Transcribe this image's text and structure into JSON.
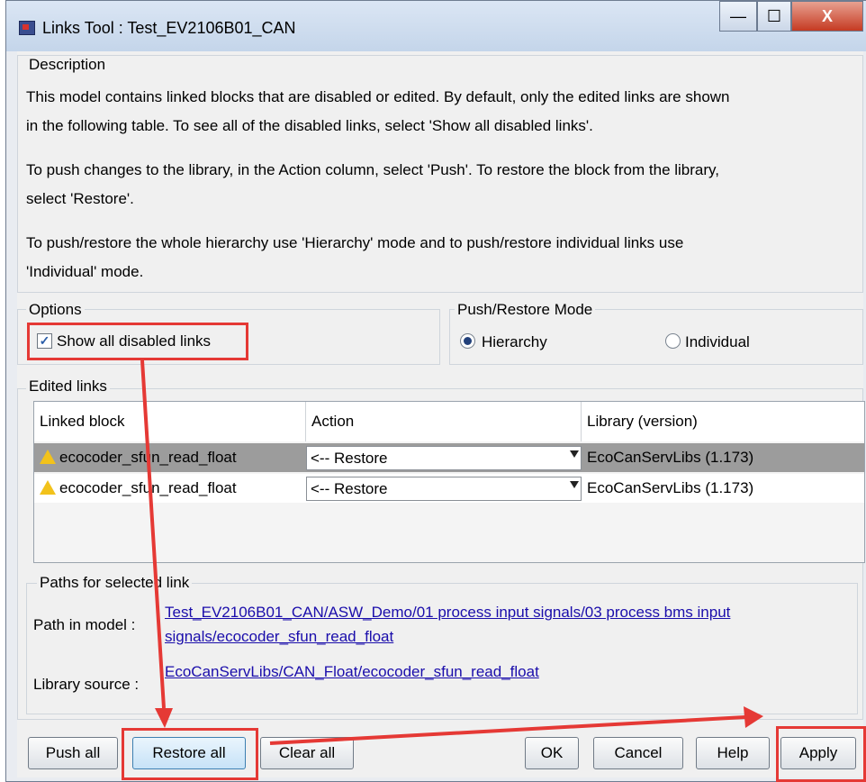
{
  "window": {
    "title": "Links Tool : Test_EV2106B01_CAN",
    "minimize": "—",
    "maximize": "☐",
    "close": "X"
  },
  "description": {
    "label": "Description",
    "lines": [
      "This model contains linked blocks that are disabled or edited. By default, only the edited links are shown",
      "in the following table. To see all of the disabled links, select 'Show all disabled links'.",
      "To push changes to the library, in the Action column, select 'Push'. To restore the block from the library,",
      "select 'Restore'.",
      "To push/restore the whole hierarchy use 'Hierarchy' mode and to push/restore individual links use",
      "'Individual' mode."
    ]
  },
  "options": {
    "label": "Options",
    "show_all_disabled": "Show all disabled links",
    "checked": true
  },
  "mode": {
    "label": "Push/Restore Mode",
    "hierarchy": "Hierarchy",
    "individual": "Individual",
    "selected": "Hierarchy"
  },
  "edited_links": {
    "label": "Edited links",
    "columns": [
      "Linked block",
      "Action",
      "Library (version)"
    ],
    "rows": [
      {
        "block": "ecocoder_sfun_read_float",
        "action": "<-- Restore",
        "library": "EcoCanServLibs (1.173)"
      },
      {
        "block": "ecocoder_sfun_read_float",
        "action": "<-- Restore",
        "library": "EcoCanServLibs (1.173)"
      }
    ]
  },
  "paths": {
    "label": "Paths for selected link",
    "path_label": "Path in model  :",
    "path_line1": "Test_EV2106B01_CAN/ASW_Demo/01 process input signals/03 process bms input",
    "path_line2": "signals/ecocoder_sfun_read_float",
    "source_label": "Library source :",
    "source_value": "EcoCanServLibs/CAN_Float/ecocoder_sfun_read_float"
  },
  "buttons": {
    "push_all": "Push all",
    "restore_all": "Restore all",
    "clear_all": "Clear all",
    "ok": "OK",
    "cancel": "Cancel",
    "help": "Help",
    "apply": "Apply"
  },
  "colors": {
    "annotation": "#e53935",
    "selected_row": "#9c9c9c",
    "link": "#1a0dab"
  }
}
